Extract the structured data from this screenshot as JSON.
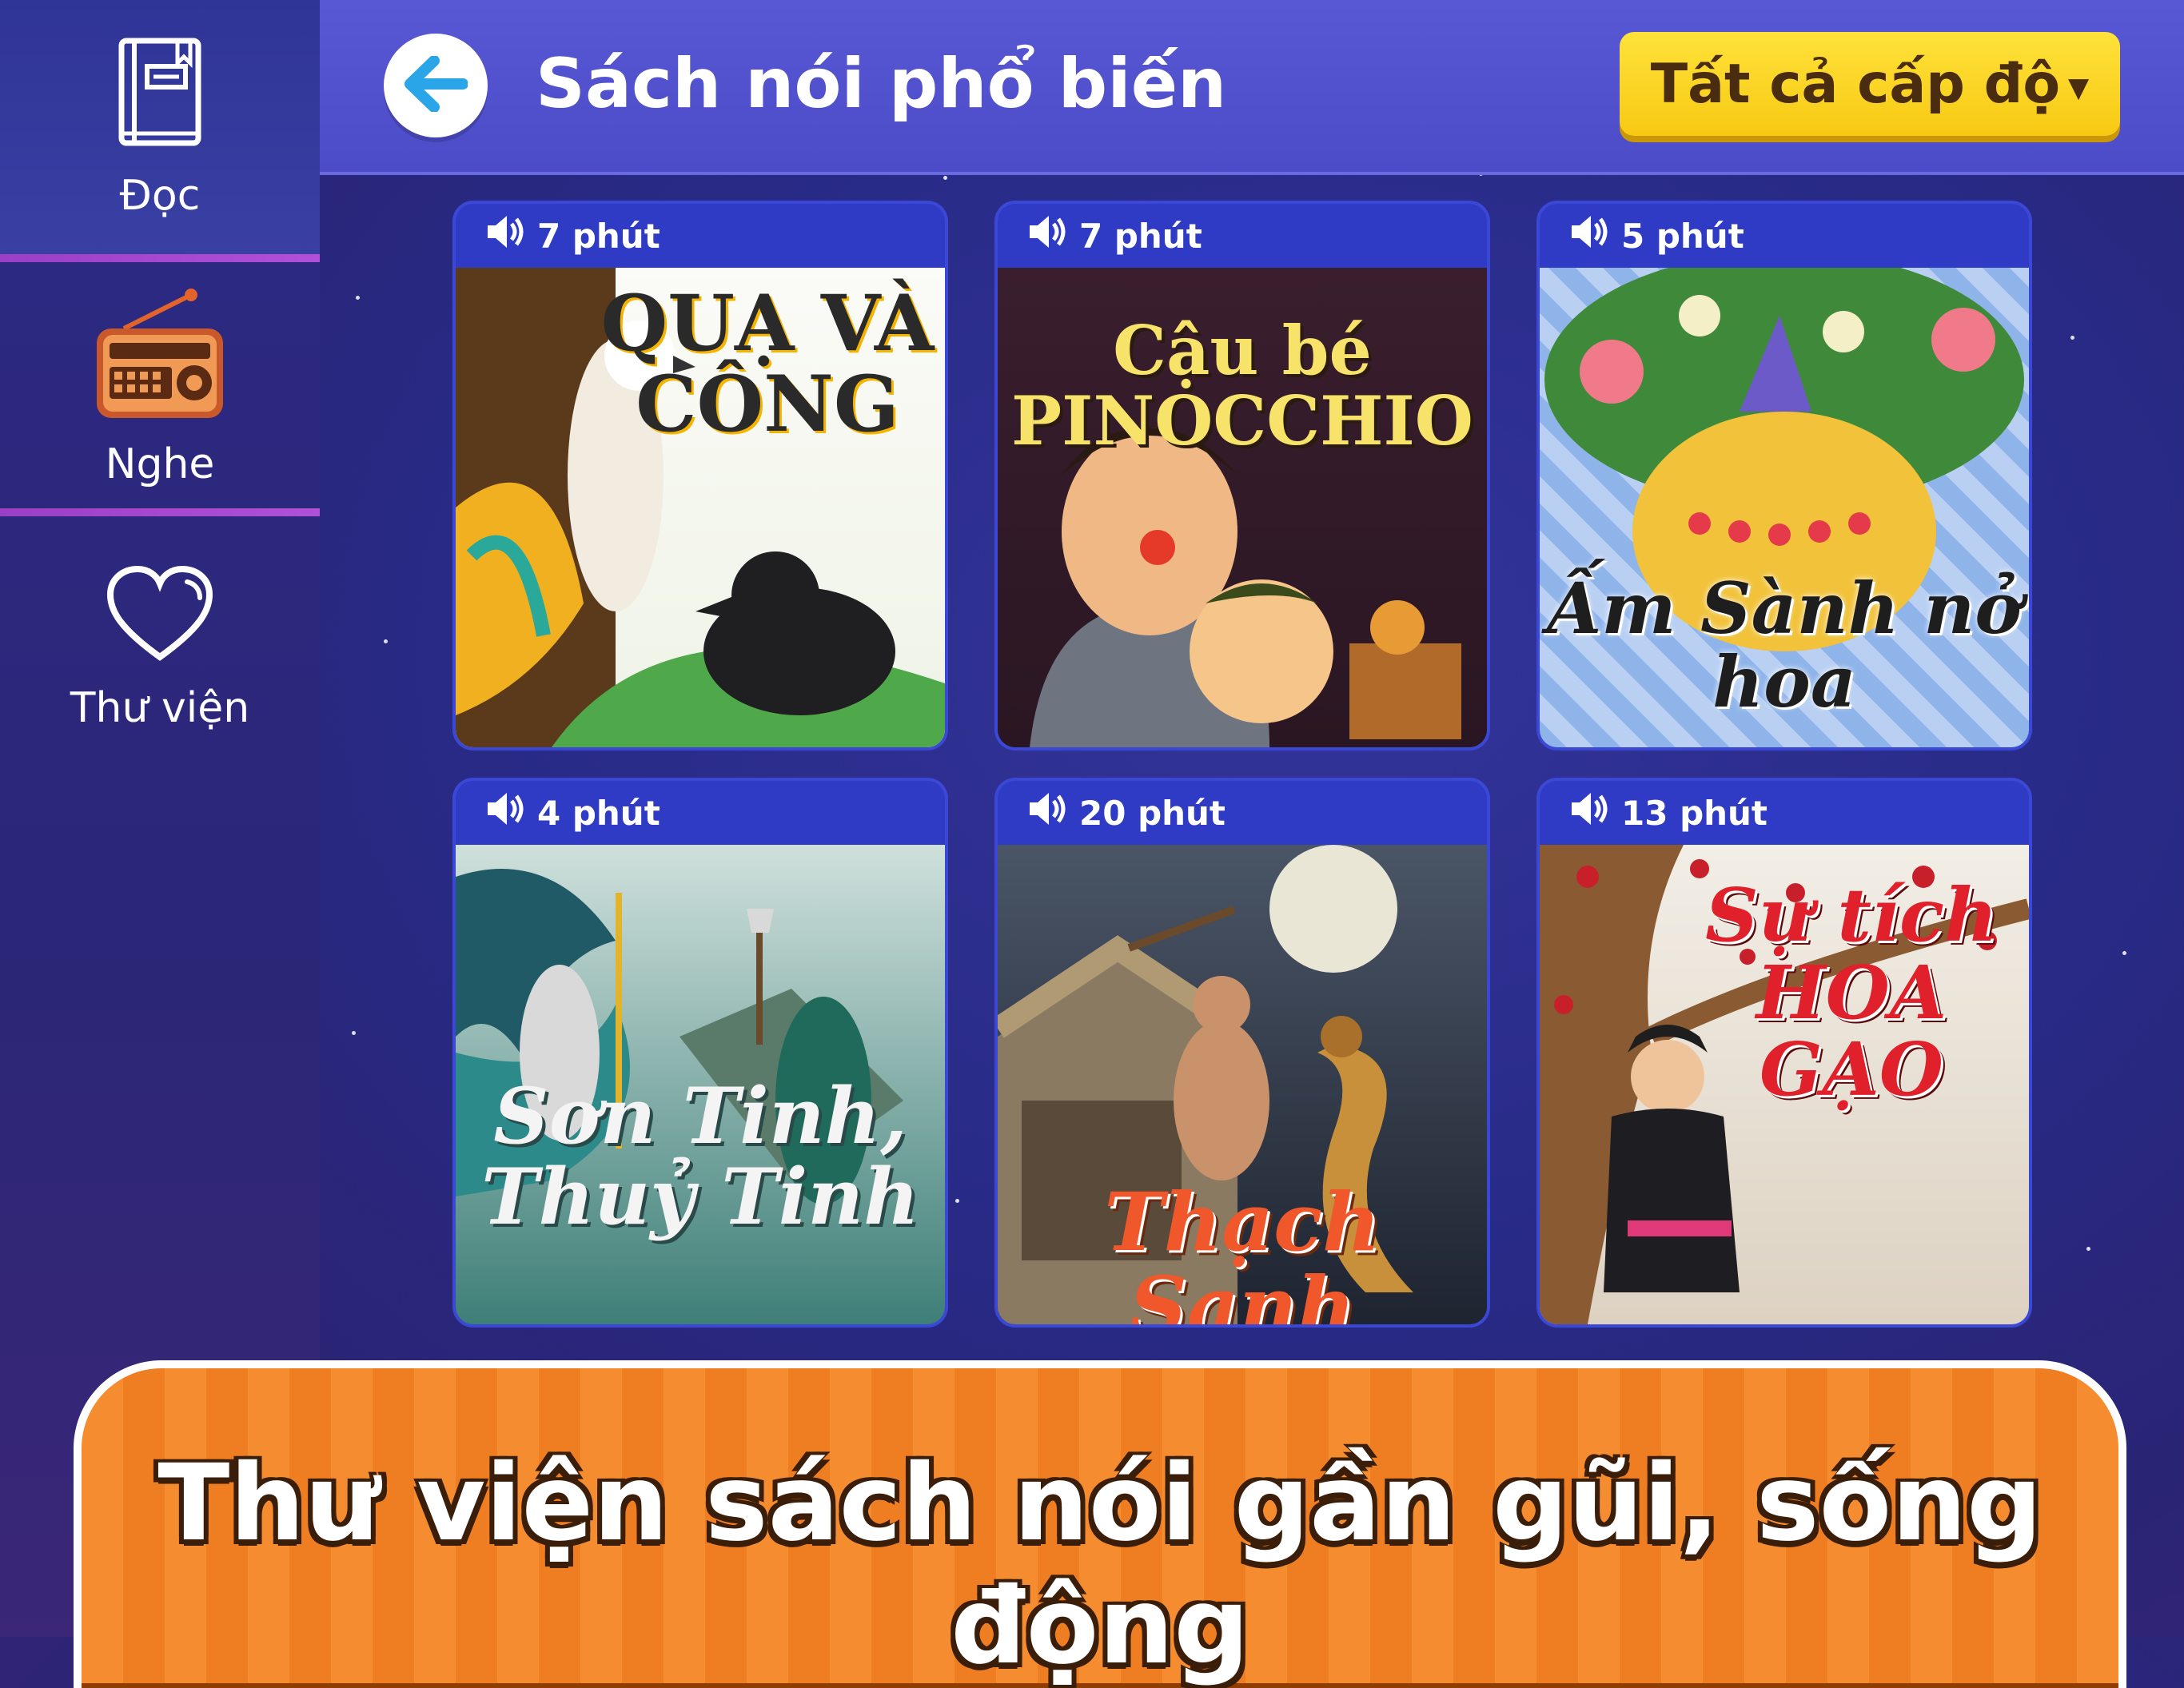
{
  "sidebar": {
    "items": [
      {
        "label": "Đọc",
        "icon": "book-icon",
        "active": true
      },
      {
        "label": "Nghe",
        "icon": "radio-icon",
        "active": false
      },
      {
        "label": "Thư viện",
        "icon": "heart-icon",
        "active": false
      }
    ]
  },
  "header": {
    "title": "Sách nói phổ biến",
    "level_filter": "Tất cả cấp độ"
  },
  "cards": [
    {
      "duration": "7 phút",
      "title": "QUẠ VÀ CÔNG"
    },
    {
      "duration": "7 phút",
      "title": "Cậu bé PINOCCHIO"
    },
    {
      "duration": "5 phút",
      "title": "Ấm Sành nở hoa"
    },
    {
      "duration": "4 phút",
      "title": "Sơn Tinh, Thuỷ Tinh"
    },
    {
      "duration": "20 phút",
      "title": "Thạch Sanh"
    },
    {
      "duration": "13 phút",
      "title": "Sự tích HOA GẠO"
    }
  ],
  "banner": {
    "text": "Thư viện sách nói gần gũi, sống động"
  },
  "colors": {
    "accent": "#f7c913",
    "card_bar": "#2f3bc4",
    "banner": "#f58c2f"
  }
}
